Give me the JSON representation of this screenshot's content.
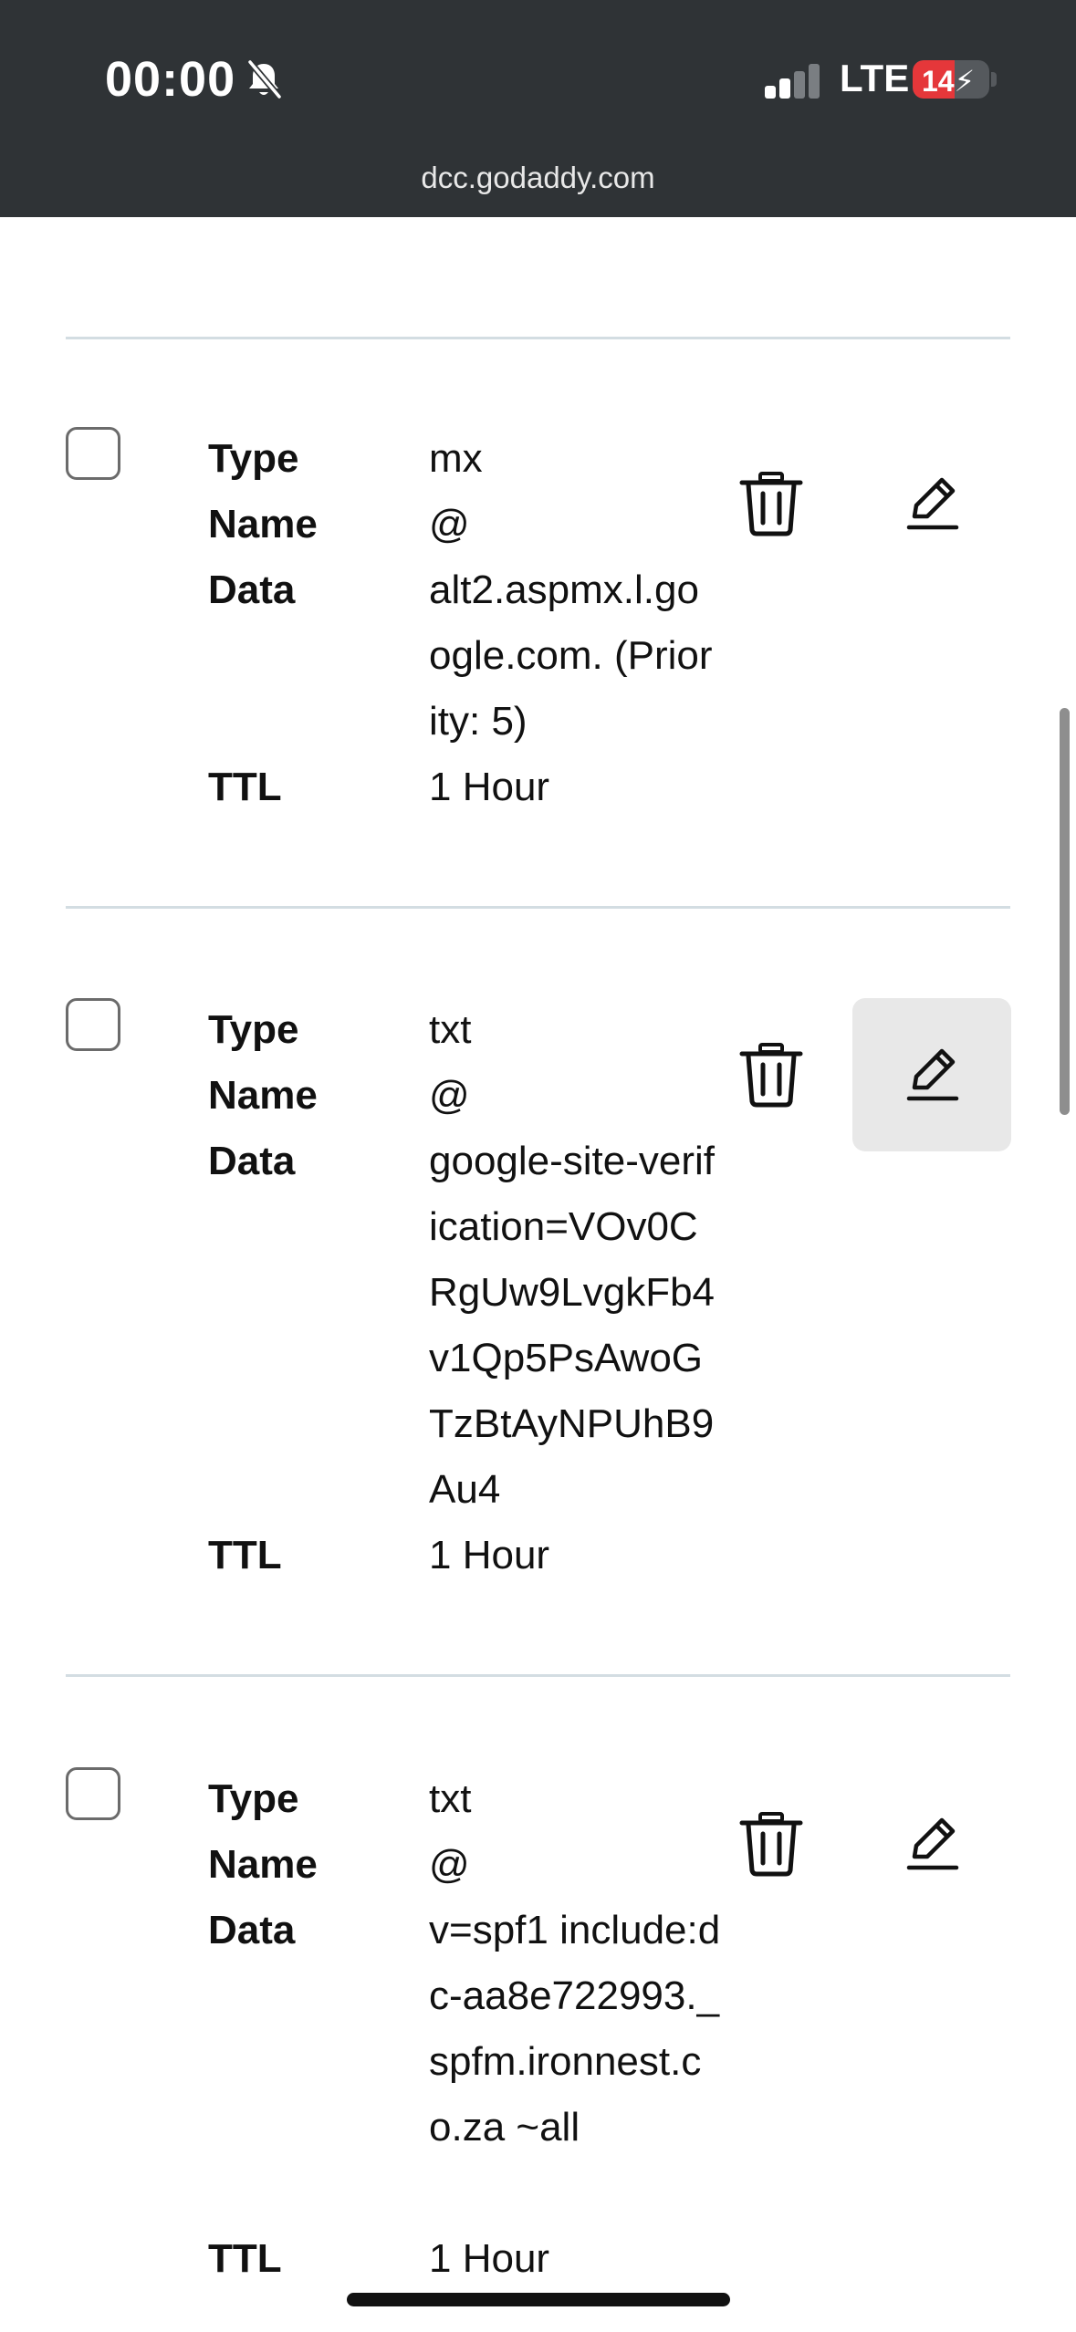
{
  "status_bar": {
    "time": "00:00",
    "network": "LTE",
    "battery": "14",
    "battery_level": 0.14
  },
  "browser": {
    "url": "dcc.godaddy.com"
  },
  "labels": {
    "type": "Type",
    "name": "Name",
    "data": "Data",
    "ttl": "TTL"
  },
  "records": [
    {
      "type": "mx",
      "name": "@",
      "data": "alt2.aspmx.l.google.com. (Priority: 5)",
      "ttl": "1 Hour"
    },
    {
      "type": "txt",
      "name": "@",
      "data": "google-site-verification=VOv0CRgUw9LvgkFb4v1Qp5PsAwoGTzBtAyNPUhB9Au4",
      "ttl": "1 Hour"
    },
    {
      "type": "txt",
      "name": "@",
      "data": "v=spf1 include:dc-aa8e722993._spfm.ironnest.co.za ~all",
      "ttl": "1 Hour"
    }
  ],
  "icons": {
    "delete": "trash-icon",
    "edit": "pencil-icon",
    "silent": "bell-slash-icon"
  },
  "colors": {
    "top_bar": "#2f3336",
    "battery_low": "#e5373a",
    "divider": "#d3dde2",
    "edit_hover": "#e8e8e8"
  }
}
